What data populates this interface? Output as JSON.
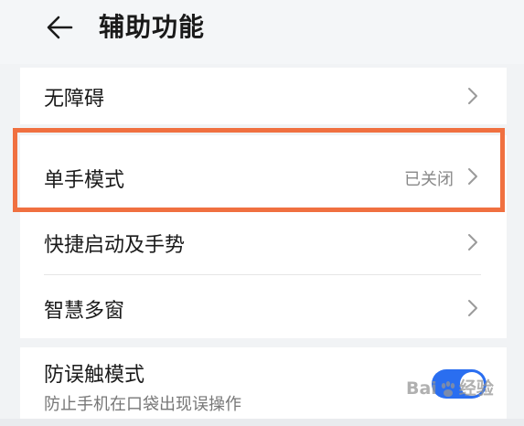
{
  "header": {
    "back_icon": "arrow-left-icon",
    "title": "辅助功能"
  },
  "settings": {
    "items": [
      {
        "label": "无障碍",
        "value": ""
      },
      {
        "label": "单手模式",
        "value": "已关闭"
      },
      {
        "label": "快捷启动及手势",
        "value": ""
      },
      {
        "label": "智慧多窗",
        "value": ""
      }
    ],
    "toggle_item": {
      "label": "防误触模式",
      "description": "防止手机在口袋出现误操作",
      "enabled": true
    }
  },
  "highlight": {
    "target": "单手模式",
    "color": "#f07040"
  },
  "watermark": {
    "left_text": "Bai",
    "right_text": "经验"
  },
  "colors": {
    "accent": "#2a6ef0",
    "background": "#f1f3f5",
    "card": "#ffffff"
  }
}
